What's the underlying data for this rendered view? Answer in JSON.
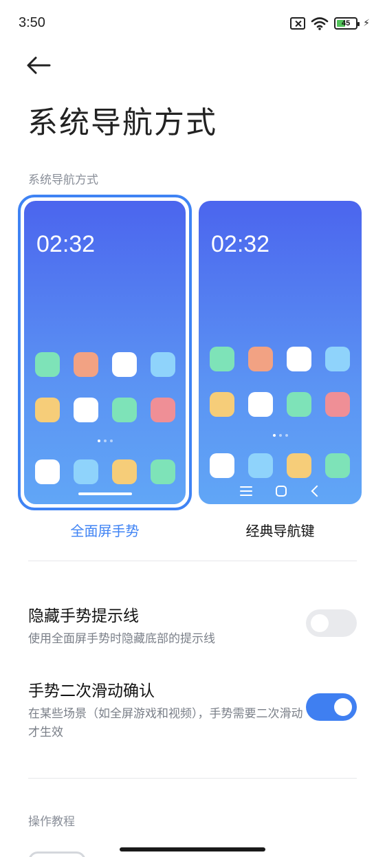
{
  "status_bar": {
    "time": "3:50",
    "battery_level": "45",
    "icons": [
      "sim-disabled-icon",
      "wifi-icon",
      "battery-icon",
      "charging-icon"
    ]
  },
  "header": {
    "back_icon": "arrow-left-icon",
    "title": "系统导航方式"
  },
  "nav_section": {
    "label": "系统导航方式",
    "options": [
      {
        "caption": "全面屏手势",
        "preview_time": "02:32",
        "selected": true
      },
      {
        "caption": "经典导航键",
        "preview_time": "02:32",
        "selected": false
      }
    ]
  },
  "settings": [
    {
      "title": "隐藏手势提示线",
      "description": "使用全面屏手势时隐藏底部的提示线",
      "enabled": false
    },
    {
      "title": "手势二次滑动确认",
      "description": "在某些场景（如全屏游戏和视频），手势需要二次滑动才生效",
      "enabled": true
    }
  ],
  "tutorial_section": {
    "label": "操作教程"
  },
  "colors": {
    "accent": "#3f83f4",
    "toggle_on": "#3f7ff1",
    "preview_gradient_top": "#4b65ee",
    "preview_gradient_bottom": "#61a6f6"
  }
}
